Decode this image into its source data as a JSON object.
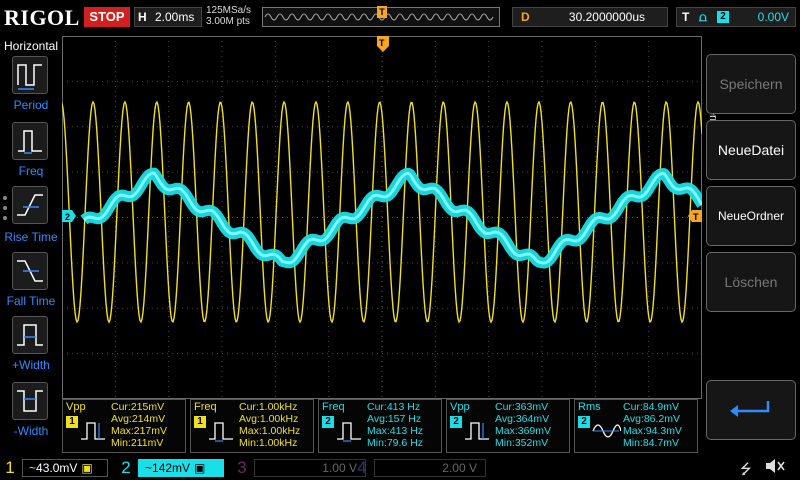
{
  "topbar": {
    "logo": "RIGOL",
    "run_state": "STOP",
    "timebase_label": "H",
    "timebase_value": "2.00ms",
    "sample_rate": "125MSa/s",
    "memory_depth": "3.00M pts",
    "delay_label": "D",
    "delay_value": "30.2000000us",
    "trigger_label": "T",
    "trigger_edge": "rising-edge-icon",
    "trigger_source": "2",
    "trigger_level": "0.00V",
    "trigger_marker": "T"
  },
  "left_panel": {
    "title": "Horizontal",
    "items": [
      {
        "label": "Period",
        "icon": "period-icon"
      },
      {
        "label": "Freq",
        "icon": "frequency-icon"
      },
      {
        "label": "Rise Time",
        "icon": "rise-time-icon"
      },
      {
        "label": "Fall Time",
        "icon": "fall-time-icon"
      },
      {
        "label": "+Width",
        "icon": "positive-width-icon"
      },
      {
        "label": "-Width",
        "icon": "negative-width-icon"
      }
    ]
  },
  "right_panel": {
    "title": "Speichern",
    "keys": [
      {
        "label": "Speichern",
        "enabled": false
      },
      {
        "label": "NeueDatei",
        "enabled": true
      },
      {
        "label": "NeueOrdner",
        "enabled": true
      },
      {
        "label": "Löschen",
        "enabled": false
      },
      {
        "label": "",
        "icon": "return-arrow-icon",
        "enabled": true
      }
    ]
  },
  "graticule": {
    "ch2_marker": "2",
    "trigger_level_marker": "T"
  },
  "measurements": [
    {
      "name": "Vpp",
      "channel": "1",
      "cur": "Cur:215mV",
      "avg": "Avg:214mV",
      "max": "Max:217mV",
      "min": "Min:211mV"
    },
    {
      "name": "Freq",
      "channel": "1",
      "cur": "Cur:1.00kHz",
      "avg": "Avg:1.00kHz",
      "max": "Max:1.00kHz",
      "min": "Min:1.00kHz"
    },
    {
      "name": "Freq",
      "channel": "2",
      "cur": "Cur:413 Hz",
      "avg": "Avg:157 Hz",
      "max": "Max:413 Hz",
      "min": "Min:79.6 Hz"
    },
    {
      "name": "Vpp",
      "channel": "2",
      "cur": "Cur:363mV",
      "avg": "Avg:364mV",
      "max": "Max:369mV",
      "min": "Min:352mV"
    },
    {
      "name": "Rms",
      "channel": "2",
      "cur": "Cur:84.9mV",
      "avg": "Avg:86.2mV",
      "max": "Max:94.3mV",
      "min": "Min:84.7mV"
    }
  ],
  "channels": [
    {
      "num": "1",
      "scale": "43.0mV",
      "color": "#f0e020",
      "active": true
    },
    {
      "num": "2",
      "scale": "142mV",
      "color": "#19e0e8",
      "active": true
    },
    {
      "num": "3",
      "scale": "1.00 V",
      "color": "#c030a0",
      "active": false
    },
    {
      "num": "4",
      "scale": "2.00 V",
      "color": "#3060e0",
      "active": false
    }
  ],
  "coupling_symbol": "~",
  "status_icons": [
    "usb-icon",
    "mute-icon"
  ],
  "colors": {
    "ch1": "#f0e020",
    "ch2": "#19e0e8",
    "trigger": "#f5a623",
    "stop": "#d02020",
    "accent": "#2f8cff"
  }
}
